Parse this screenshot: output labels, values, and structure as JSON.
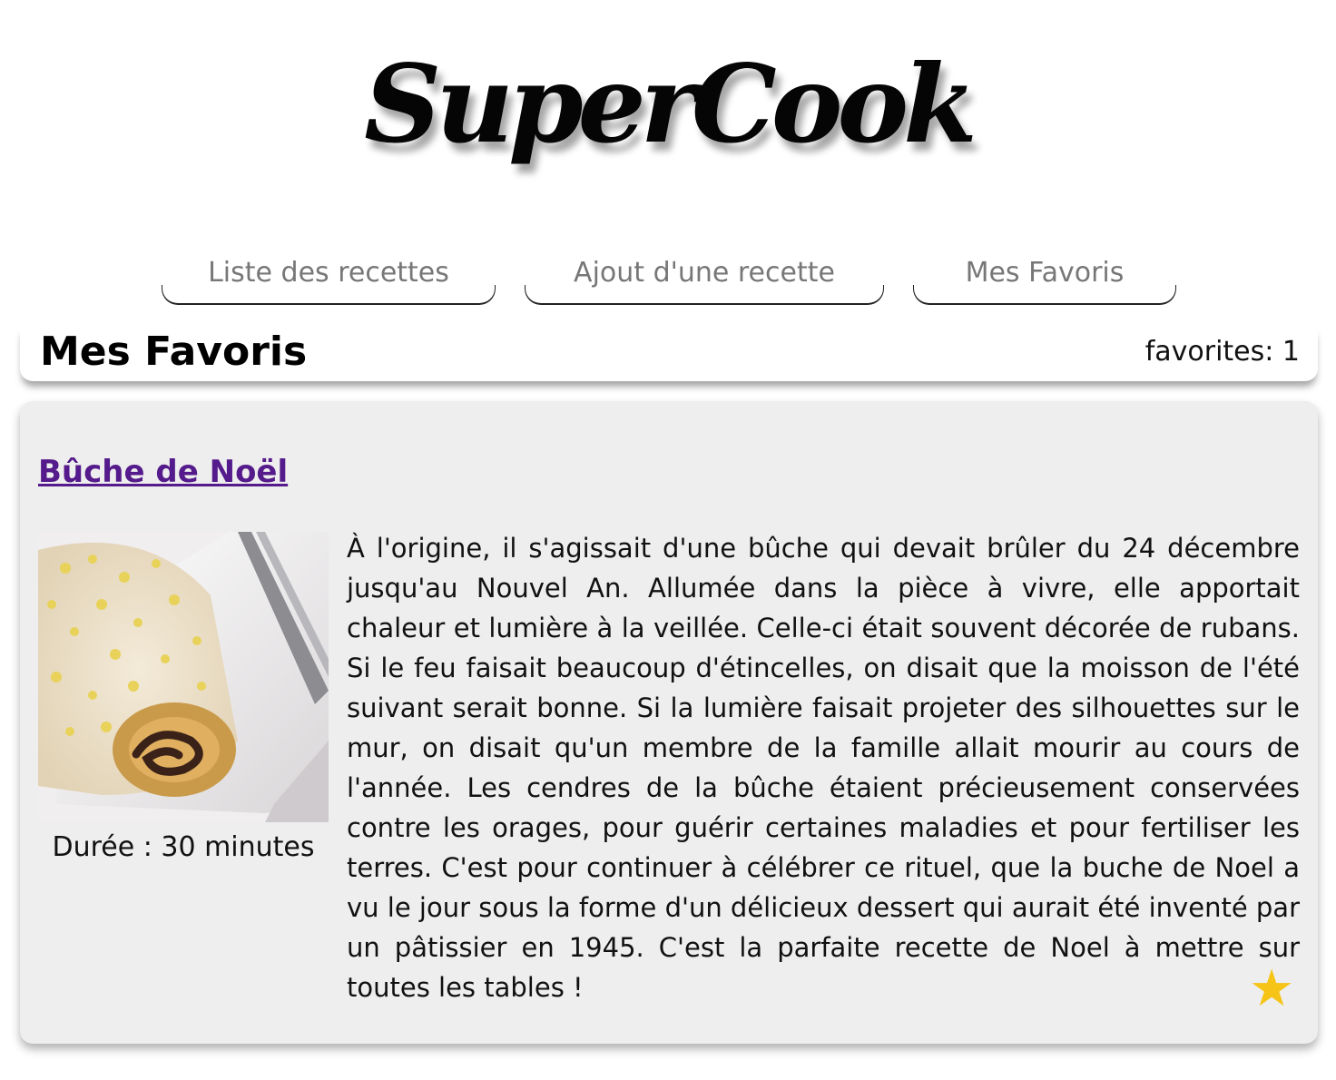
{
  "app": {
    "logo": "SuperCook"
  },
  "nav": {
    "tabs": [
      {
        "label": "Liste des recettes"
      },
      {
        "label": "Ajout d'une recette"
      },
      {
        "label": "Mes Favoris"
      }
    ]
  },
  "header": {
    "title": "Mes Favoris",
    "favorites_count": "favorites: 1"
  },
  "recipe": {
    "title": "Bûche de Noël",
    "duration": "Durée : 30 minutes",
    "description": "À l'origine, il s'agissait d'une bûche qui devait brûler du 24 décembre jusqu'au Nouvel An. Allumée dans la pièce à vivre, elle apportait chaleur et lumière à la veillée. Celle-ci était souvent décorée de rubans. Si le feu faisait beaucoup d'étincelles, on disait que la moisson de l'été suivant serait bonne. Si la lumière faisait projeter des silhouettes sur le mur, on disait qu'un membre de la famille allait mourir au cours de l'année. Les cendres de la bûche étaient précieusement conservées contre les orages, pour guérir certaines maladies et pour fertiliser les terres. C'est pour continuer à célébrer ce rituel, que la buche de Noel a vu le jour sous la forme d'un délicieux dessert qui aurait été inventé par un pâtissier en 1945. C'est la parfaite recette de Noel à mettre sur toutes les tables !",
    "favorite_icon": "star-icon",
    "favorite_color": "#f6c416"
  },
  "colors": {
    "link": "#551a8b",
    "card_background": "#eeeeee"
  }
}
